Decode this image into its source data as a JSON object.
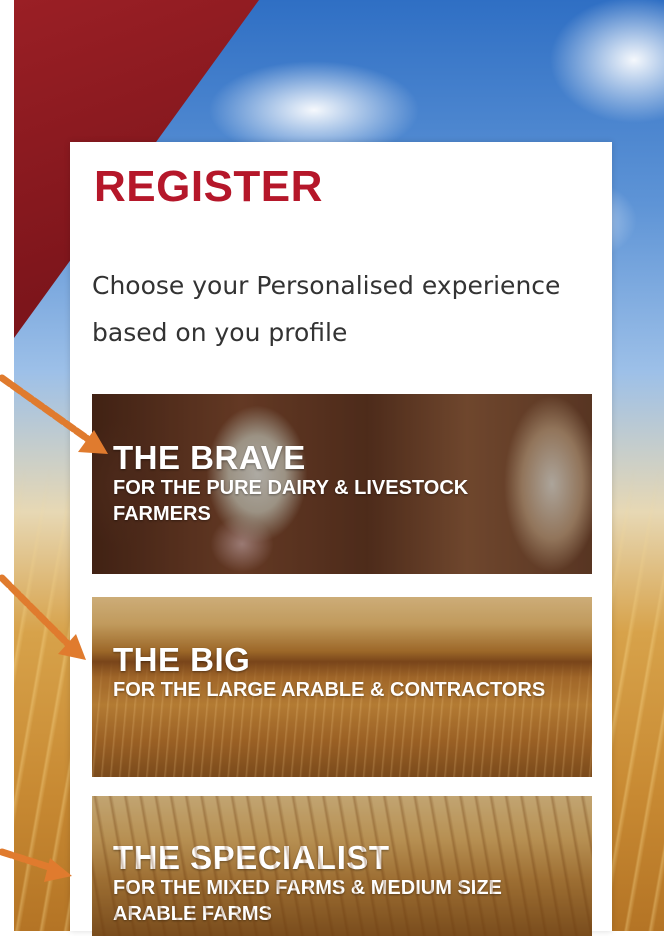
{
  "header": {
    "title": "REGISTER"
  },
  "intro": {
    "text": "Choose your Personalised experience based on you profile"
  },
  "profiles": [
    {
      "name": "THE BRAVE",
      "description": "FOR THE PURE DAIRY & LIVESTOCK FARMERS"
    },
    {
      "name": "THE BIG",
      "description": "FOR THE LARGE ARABLE & CONTRACTORS"
    },
    {
      "name": "THE SPECIALIST",
      "description": "FOR THE MIXED FARMS & MEDIUM SIZE ARABLE FARMS"
    }
  ],
  "colors": {
    "title_red": "#b5172a",
    "annotation_arrow": "#e07b2e",
    "panel_bg": "#ffffff"
  }
}
